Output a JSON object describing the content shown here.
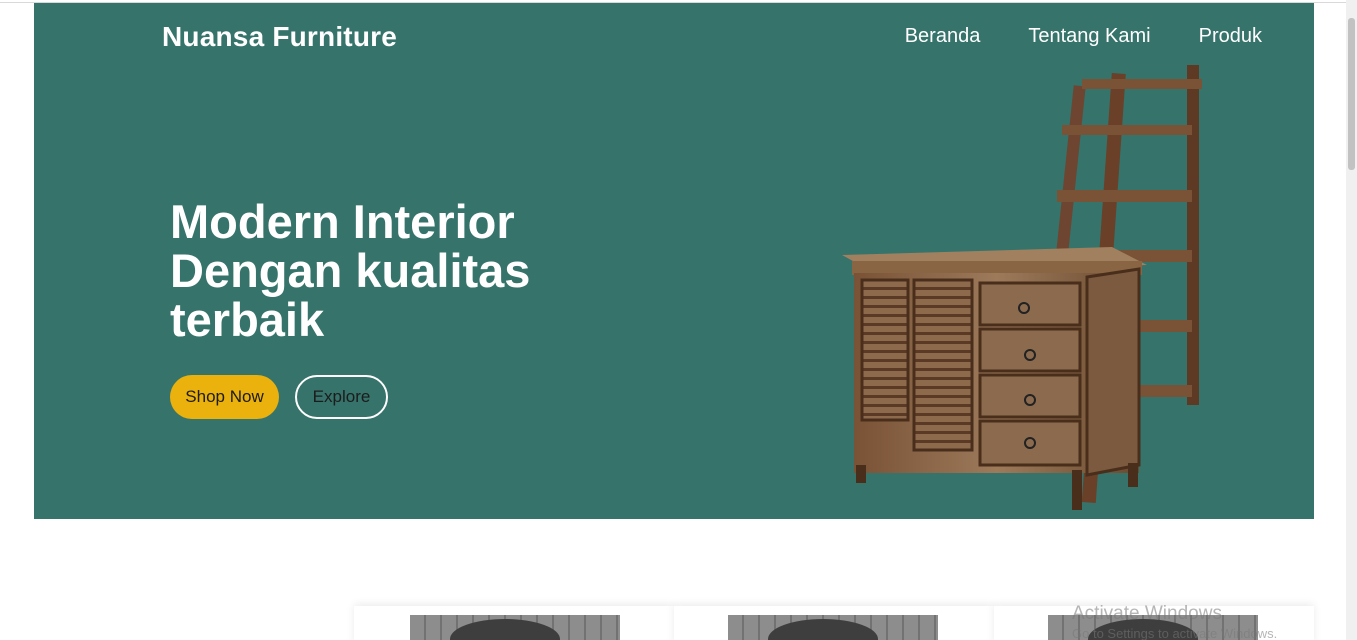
{
  "header": {
    "brand": "Nuansa Furniture",
    "nav": [
      "Beranda",
      "Tentang Kami",
      "Produk"
    ]
  },
  "hero": {
    "headline_lines": [
      "Modern Interior",
      "Dengan kualitas",
      "terbaik"
    ],
    "primary_button": "Shop Now",
    "secondary_button": "Explore",
    "image": "rustic-wooden-cabinet-with-ladder-shelf"
  },
  "watermark": {
    "title": "Activate Windows",
    "subtitle": "Go to Settings to activate Windows."
  },
  "colors": {
    "hero_bg": "#36736b",
    "accent": "#ebb10c",
    "text_on_hero": "#ffffff"
  }
}
